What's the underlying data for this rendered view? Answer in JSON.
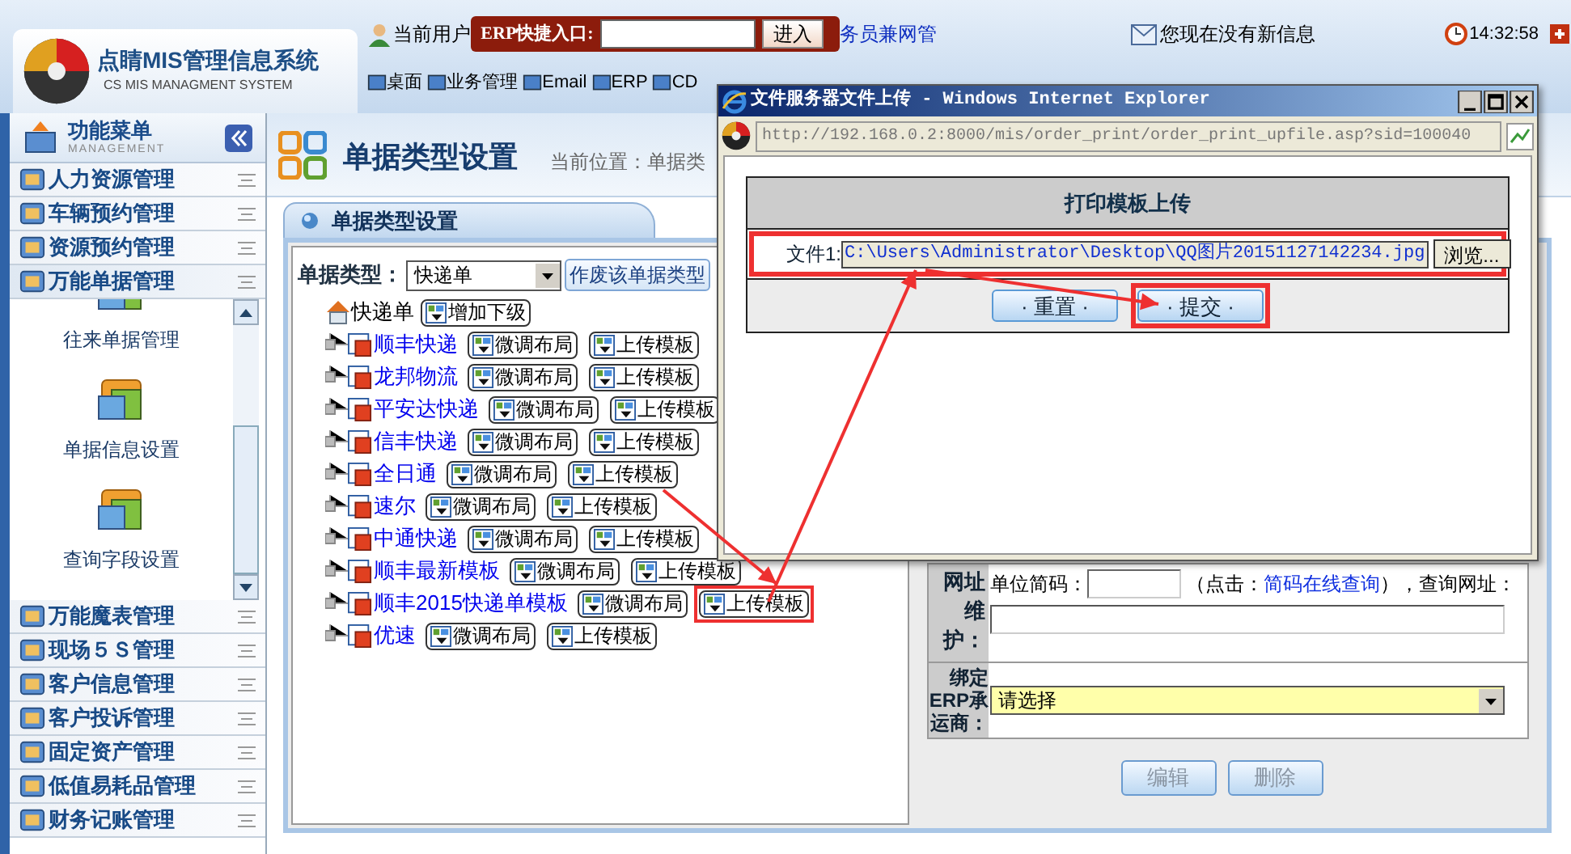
{
  "header": {
    "logo_title": "点睛MIS管理信息系统",
    "logo_subtitle": "CS MIS MANAGMENT SYSTEM",
    "user_label": "当前用户",
    "erp_label": "ERP快捷入口:",
    "erp_button": "进入",
    "user_role": "务员兼网管",
    "message": "您现在没有新信息",
    "time": "14:32:58",
    "nav": [
      "桌面",
      "业务管理",
      "Email",
      "ERP",
      "CD"
    ]
  },
  "sidebar": {
    "title": "功能菜单",
    "subtitle": "MANAGEMENT",
    "groups": [
      {
        "label": "人力资源管理",
        "expanded": false
      },
      {
        "label": "车辆预约管理",
        "expanded": false
      },
      {
        "label": "资源预约管理",
        "expanded": false
      },
      {
        "label": "万能单据管理",
        "expanded": true,
        "children": [
          "往来单据管理",
          "单据信息设置",
          "查询字段设置"
        ]
      },
      {
        "label": "万能魔表管理",
        "expanded": false
      },
      {
        "label": "现场５Ｓ管理",
        "expanded": false
      },
      {
        "label": "客户信息管理",
        "expanded": false
      },
      {
        "label": "客户投诉管理",
        "expanded": false
      },
      {
        "label": "固定资产管理",
        "expanded": false
      },
      {
        "label": "低值易耗品管理",
        "expanded": false
      },
      {
        "label": "财务记账管理",
        "expanded": false
      }
    ]
  },
  "page": {
    "title": "单据类型设置",
    "breadcrumb": "当前位置：单据类",
    "panel_title": "单据类型设置",
    "type_label": "单据类型：",
    "type_value": "快递单",
    "void_button": "作废该单据类型",
    "tree": {
      "label": "快递单",
      "button": "增加下级",
      "children": [
        {
          "label": "顺丰快递",
          "buttons": [
            {
              "label": "微调布局",
              "highlighted": false
            },
            {
              "label": "上传模板",
              "highlighted": false
            }
          ]
        },
        {
          "label": "龙邦物流",
          "buttons": [
            {
              "label": "微调布局",
              "highlighted": false
            },
            {
              "label": "上传模板",
              "highlighted": false
            }
          ]
        },
        {
          "label": "平安达快递",
          "buttons": [
            {
              "label": "微调布局",
              "highlighted": false
            },
            {
              "label": "上传模板",
              "highlighted": false
            }
          ]
        },
        {
          "label": "信丰快递",
          "buttons": [
            {
              "label": "微调布局",
              "highlighted": false
            },
            {
              "label": "上传模板",
              "highlighted": false
            }
          ]
        },
        {
          "label": "全日通",
          "buttons": [
            {
              "label": "微调布局",
              "highlighted": false
            },
            {
              "label": "上传模板",
              "highlighted": false
            }
          ]
        },
        {
          "label": "速尔",
          "buttons": [
            {
              "label": "微调布局",
              "highlighted": false
            },
            {
              "label": "上传模板",
              "highlighted": false
            }
          ]
        },
        {
          "label": "中通快递",
          "buttons": [
            {
              "label": "微调布局",
              "highlighted": false
            },
            {
              "label": "上传模板",
              "highlighted": false
            }
          ]
        },
        {
          "label": "顺丰最新模板",
          "buttons": [
            {
              "label": "微调布局",
              "highlighted": false
            },
            {
              "label": "上传模板",
              "highlighted": false
            }
          ]
        },
        {
          "label": "顺丰2015快递单模板",
          "buttons": [
            {
              "label": "微调布局",
              "highlighted": false
            },
            {
              "label": "上传模板",
              "highlighted": true
            }
          ]
        },
        {
          "label": "优速",
          "buttons": [
            {
              "label": "微调布局",
              "highlighted": false
            },
            {
              "label": "上传模板",
              "highlighted": false
            }
          ]
        }
      ]
    },
    "form": {
      "url_label": "网址维护：",
      "code_label": "单位简码：",
      "hint_open": "（点击：",
      "hint_link": "简码在线查询",
      "hint_close": "），查询网址：",
      "carrier_label": "绑定ERP承运商：",
      "carrier_value": "请选择",
      "buttons": [
        {
          "label": "编辑",
          "disabled": true
        },
        {
          "label": "删除",
          "disabled": true
        }
      ]
    }
  },
  "popup": {
    "title": "文件服务器文件上传 - Windows Internet Explorer",
    "address": "http://192.168.0.2:8000/mis/order_print/order_print_upfile.asp?sid=100040",
    "heading": "打印模板上传",
    "file_label": "文件1:",
    "file_value": "C:\\Users\\Administrator\\Desktop\\QQ图片20151127142234.jpg",
    "file_row_highlighted": true,
    "browse_button": "浏览...",
    "buttons": [
      {
        "label": "· 重置 ·",
        "highlighted": false
      },
      {
        "label": "· 提交 ·",
        "highlighted": true
      }
    ]
  }
}
